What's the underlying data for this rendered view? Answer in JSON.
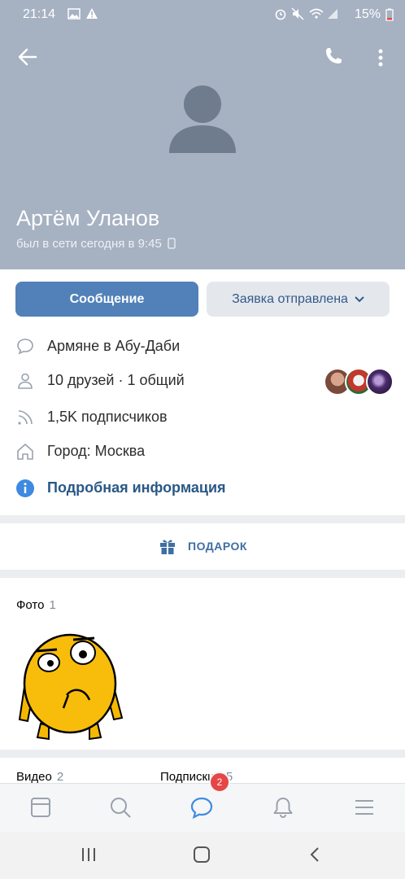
{
  "status": {
    "time": "21:14",
    "battery": "15%"
  },
  "profile": {
    "name": "Артём Уланов",
    "online": "был в сети сегодня в 9:45"
  },
  "actions": {
    "message": "Сообщение",
    "request": "Заявка отправлена"
  },
  "info": {
    "group": "Армяне в Абу-Даби",
    "friends": "10 друзей · 1 общий",
    "followers": "1,5K подписчиков",
    "city": "Город: Москва",
    "more": "Подробная информация"
  },
  "gift": {
    "label": "ПОДАРОК"
  },
  "photos": {
    "title": "Фото",
    "count": "1"
  },
  "videos": {
    "title": "Видео",
    "count": "2"
  },
  "subscriptions": {
    "title": "Подписки",
    "count": "35"
  },
  "nav": {
    "messages_badge": "2"
  },
  "colors": {
    "header": "#a6b1c2",
    "accent": "#5181b8",
    "link": "#2a5885"
  }
}
